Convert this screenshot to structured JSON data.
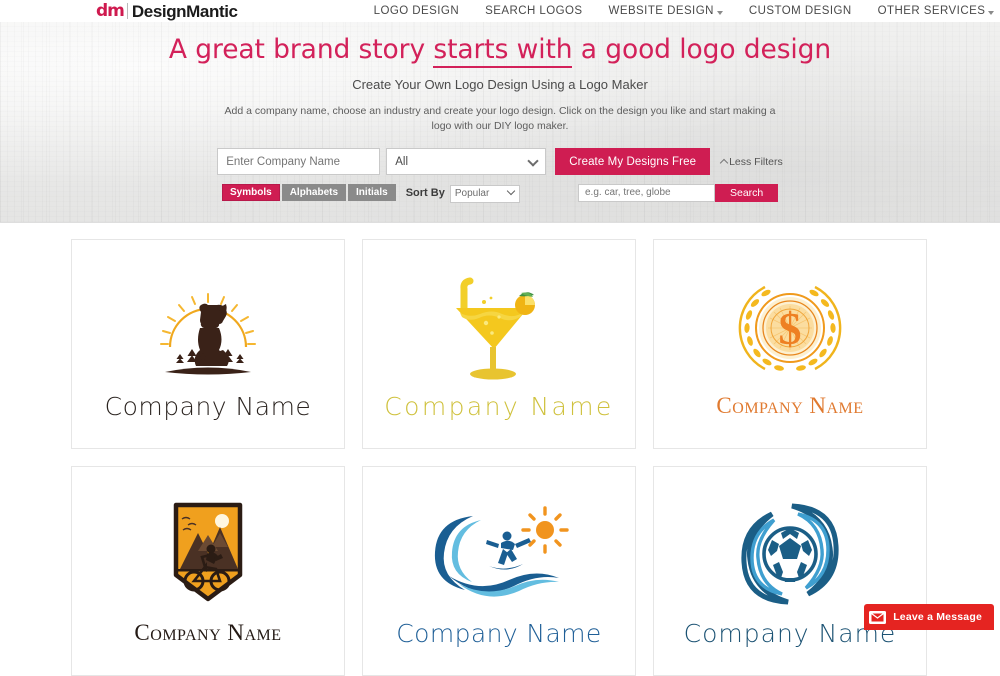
{
  "brand": {
    "mark": "dm",
    "name": "DesignMantic"
  },
  "nav": {
    "items": [
      {
        "label": "LOGO DESIGN",
        "caret": false
      },
      {
        "label": "SEARCH LOGOS",
        "caret": false
      },
      {
        "label": "WEBSITE DESIGN",
        "caret": true
      },
      {
        "label": "CUSTOM DESIGN",
        "caret": false
      },
      {
        "label": "OTHER SERVICES",
        "caret": true
      }
    ]
  },
  "hero": {
    "title_part1": "A great brand story ",
    "title_underlined": "starts with",
    "title_part2": " a good logo design",
    "subtitle": "Create Your Own Logo Design Using a Logo Maker",
    "description": "Add a company name, choose an industry and create your logo design. Click on the design you like and start making a logo with our DIY logo maker.",
    "accent_color": "#d3215a"
  },
  "form": {
    "company_placeholder": "Enter Company Name",
    "company_value": "",
    "industry_selected": "All",
    "create_button": "Create My Designs Free",
    "less_filters": "Less Filters",
    "chips": [
      {
        "label": "Symbols",
        "active": true
      },
      {
        "label": "Alphabets",
        "active": false
      },
      {
        "label": "Initials",
        "active": false
      }
    ],
    "sort_by_label": "Sort By",
    "sort_selected": "Popular",
    "keyword_placeholder": "e.g. car, tree, globe",
    "keyword_value": "",
    "search_button": "Search",
    "button_color": "#cf1d52"
  },
  "logos": [
    {
      "name": "dog-sunrise-logo",
      "company_name": "Company Name",
      "style": "thin"
    },
    {
      "name": "cocktail-logo",
      "company_name": "Company Name",
      "style": "thin-y"
    },
    {
      "name": "dollar-coin-logo",
      "company_name": "Company Name",
      "style": "serif"
    },
    {
      "name": "mountain-bike-badge-logo",
      "company_name": "Company Name",
      "style": "serif-dark"
    },
    {
      "name": "surfer-wave-logo",
      "company_name": "Company Name",
      "style": "blue"
    },
    {
      "name": "soccer-ball-logo",
      "company_name": "Company Name",
      "style": "blue-dark"
    }
  ],
  "chat": {
    "label": "Leave a Message",
    "color": "#e52421"
  }
}
